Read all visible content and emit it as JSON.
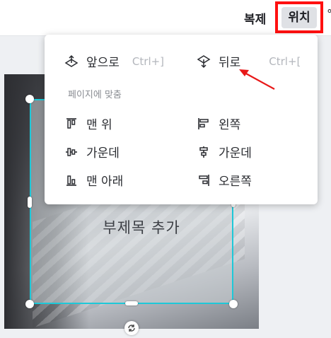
{
  "toolbar": {
    "duplicate_label": "복제",
    "position_label": "위치",
    "edge_glyph": "°"
  },
  "canvas": {
    "subtitle": "부제목 추가",
    "rotate_icon": "rotate-icon"
  },
  "menu": {
    "forward": {
      "label": "앞으로",
      "shortcut": "Ctrl+]",
      "icon": "bring-forward-icon"
    },
    "backward": {
      "label": "뒤로",
      "shortcut": "Ctrl+[",
      "icon": "send-backward-icon"
    },
    "section_title": "페이지에 맞춤",
    "align_items": [
      {
        "label": "맨 위",
        "icon": "align-top-icon"
      },
      {
        "label": "왼쪽",
        "icon": "align-left-icon"
      },
      {
        "label": "가운데",
        "icon": "align-middle-icon"
      },
      {
        "label": "가운데",
        "icon": "align-center-icon"
      },
      {
        "label": "맨 아래",
        "icon": "align-bottom-icon"
      },
      {
        "label": "오른쪽",
        "icon": "align-right-icon"
      }
    ]
  },
  "colors": {
    "highlight": "#ff1010",
    "selection": "#1ec8d8"
  }
}
